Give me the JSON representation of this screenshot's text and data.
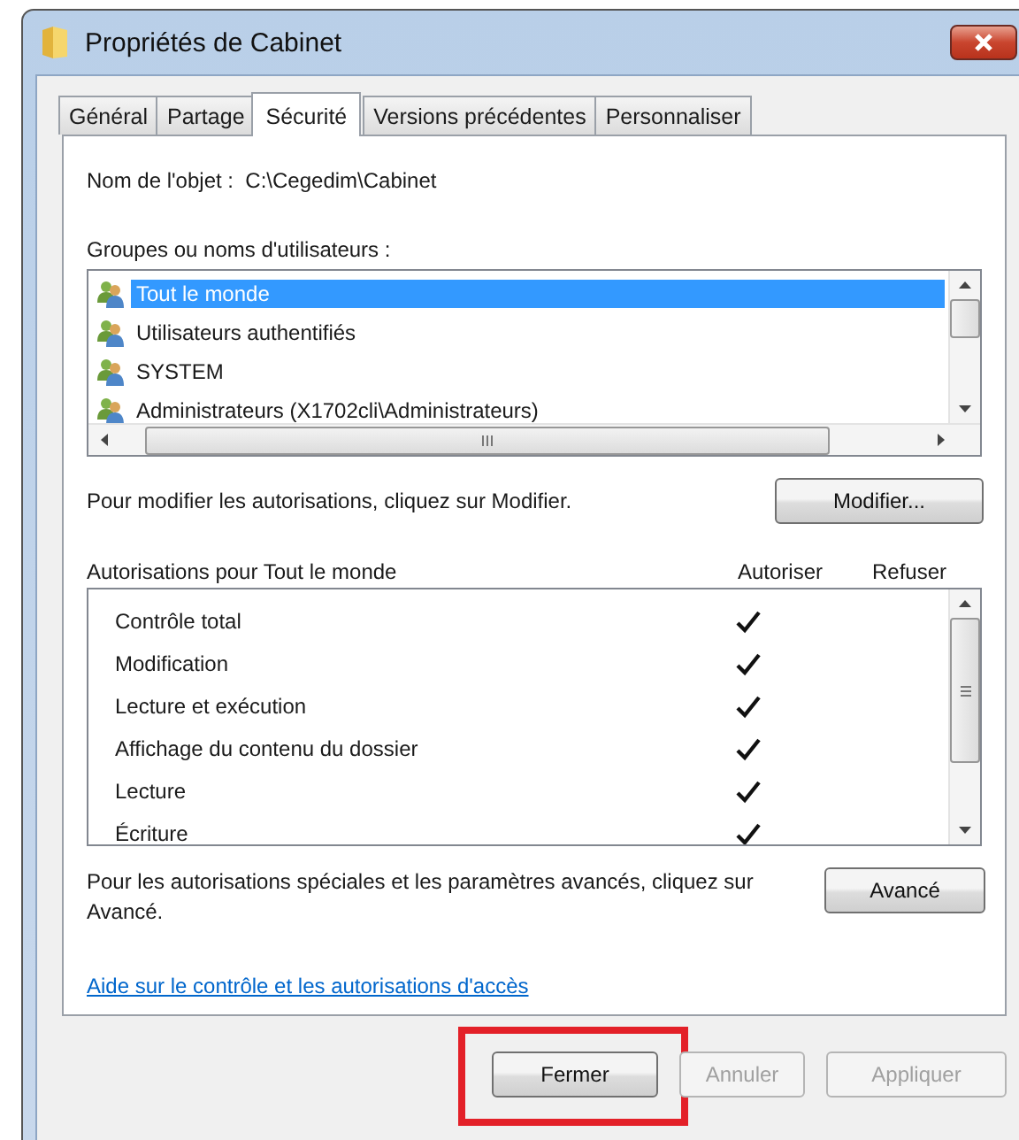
{
  "window": {
    "title": "Propriétés de Cabinet"
  },
  "tabs": [
    {
      "label": "Général",
      "selected": false
    },
    {
      "label": "Partage",
      "selected": false
    },
    {
      "label": "Sécurité",
      "selected": true
    },
    {
      "label": "Versions précédentes",
      "selected": false
    },
    {
      "label": "Personnaliser",
      "selected": false
    }
  ],
  "object_name": {
    "label": "Nom de l'objet :",
    "value": "C:\\Cegedim\\Cabinet"
  },
  "groups": {
    "label": "Groupes ou noms d'utilisateurs :",
    "items": [
      {
        "name": "Tout le monde",
        "selected": true
      },
      {
        "name": "Utilisateurs authentifiés",
        "selected": false
      },
      {
        "name": "SYSTEM",
        "selected": false
      },
      {
        "name": "Administrateurs (X1702cli\\Administrateurs)",
        "selected": false
      }
    ]
  },
  "modify": {
    "text": "Pour modifier les autorisations, cliquez sur Modifier.",
    "button": "Modifier..."
  },
  "permissions": {
    "title": "Autorisations pour Tout le monde",
    "allow_header": "Autoriser",
    "deny_header": "Refuser",
    "rows": [
      {
        "name": "Contrôle total",
        "allow": true,
        "deny": false
      },
      {
        "name": "Modification",
        "allow": true,
        "deny": false
      },
      {
        "name": "Lecture et exécution",
        "allow": true,
        "deny": false
      },
      {
        "name": "Affichage du contenu du dossier",
        "allow": true,
        "deny": false
      },
      {
        "name": "Lecture",
        "allow": true,
        "deny": false
      },
      {
        "name": "Écriture",
        "allow": true,
        "deny": false
      }
    ]
  },
  "advanced": {
    "text": "Pour les autorisations spéciales et les paramètres avancés, cliquez sur Avancé.",
    "button": "Avancé"
  },
  "help_link": "Aide sur le contrôle et les autorisations d'accès",
  "buttons": [
    {
      "label": "Fermer",
      "disabled": false,
      "highlighted": true
    },
    {
      "label": "Annuler",
      "disabled": true,
      "highlighted": false
    },
    {
      "label": "Appliquer",
      "disabled": true,
      "highlighted": false
    }
  ]
}
